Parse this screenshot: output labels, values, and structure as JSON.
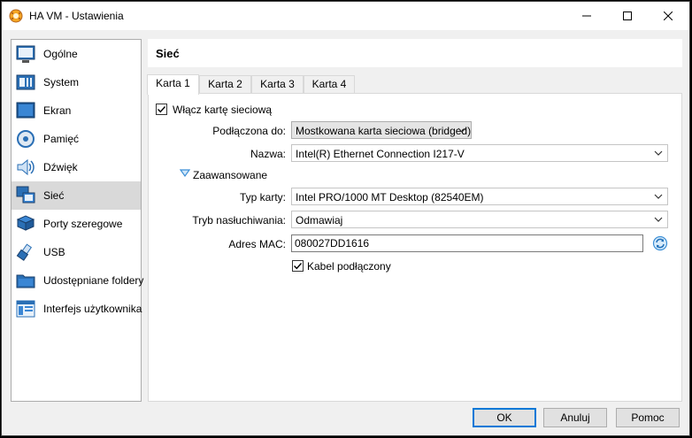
{
  "window": {
    "title": "HA VM - Ustawienia",
    "minimize_glyph": "—",
    "maximize_glyph": "☐",
    "close_glyph": "✕"
  },
  "sidebar": {
    "items": [
      {
        "label": "Ogólne",
        "icon": "general-icon",
        "selected": false
      },
      {
        "label": "System",
        "icon": "system-icon",
        "selected": false
      },
      {
        "label": "Ekran",
        "icon": "display-icon",
        "selected": false
      },
      {
        "label": "Pamięć",
        "icon": "storage-icon",
        "selected": false
      },
      {
        "label": "Dźwięk",
        "icon": "audio-icon",
        "selected": false
      },
      {
        "label": "Sieć",
        "icon": "network-icon",
        "selected": true
      },
      {
        "label": "Porty szeregowe",
        "icon": "serial-ports-icon",
        "selected": false
      },
      {
        "label": "USB",
        "icon": "usb-icon",
        "selected": false
      },
      {
        "label": "Udostępniane foldery",
        "icon": "shared-folders-icon",
        "selected": false
      },
      {
        "label": "Interfejs użytkownika",
        "icon": "user-interface-icon",
        "selected": false
      }
    ]
  },
  "section": {
    "title": "Sieć"
  },
  "tabs": [
    {
      "label": "Karta 1",
      "active": true
    },
    {
      "label": "Karta 2",
      "active": false
    },
    {
      "label": "Karta 3",
      "active": false
    },
    {
      "label": "Karta 4",
      "active": false
    }
  ],
  "adapter": {
    "enable_label": "Włącz kartę sieciową",
    "enabled": true,
    "attached_label": "Podłączona do:",
    "attached_value": "Mostkowana karta sieciowa (bridged)",
    "name_label": "Nazwa:",
    "name_value": "Intel(R) Ethernet Connection I217-V",
    "advanced_label": "Zaawansowane",
    "type_label": "Typ karty:",
    "type_value": "Intel PRO/1000 MT Desktop (82540EM)",
    "promisc_label": "Tryb nasłuchiwania:",
    "promisc_value": "Odmawiaj",
    "mac_label": "Adres MAC:",
    "mac_value": "080027DD1616",
    "cable_label": "Kabel podłączony",
    "cable_connected": true
  },
  "buttons": {
    "ok": "OK",
    "cancel": "Anuluj",
    "help": "Pomoc"
  },
  "colors": {
    "accent": "#0078d7",
    "selected_bg": "#d9d9d9",
    "expander": "#3c8fd6"
  }
}
